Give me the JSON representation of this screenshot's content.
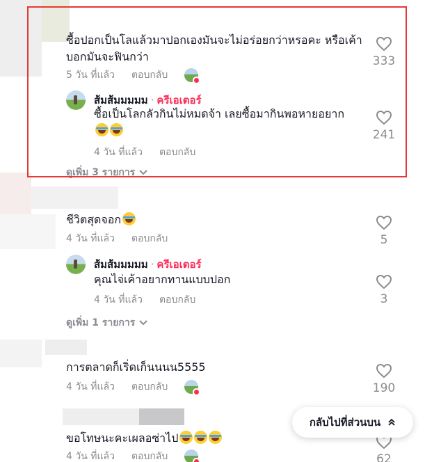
{
  "comments": [
    {
      "text": "ซื้อปอกเป็นโลแล้วมาปอกเองมันจะไม่อร่อยกว่าหรอคะ หรือเค้าบอกมันจะฟินกว่า",
      "date": "5 วัน ที่แล้ว",
      "reply_label": "ตอบกลับ",
      "likes": "333",
      "reply": {
        "name": "ส้มส้มมมมม",
        "role": "ครีเอเตอร์",
        "text": "ซื้อเป็นโลกลัวกินไม่หมดจ้า เลยซื้อมากินพอหายอยาก",
        "date": "4 วัน ที่แล้ว",
        "reply_label": "ตอบกลับ",
        "likes": "241"
      },
      "more": "ดูเพิ่ม 3 รายการ"
    },
    {
      "text": "ชีวิตสุดจอก",
      "date": "4 วัน ที่แล้ว",
      "reply_label": "ตอบกลับ",
      "likes": "5",
      "reply": {
        "name": "ส้มส้มมมมม",
        "role": "ครีเอเตอร์",
        "text": "คุณไจ่เค้าอยากทานแบบปอก",
        "date": "4 วัน ที่แล้ว",
        "reply_label": "ตอบกลับ",
        "likes": "3"
      },
      "more": "ดูเพิ่ม 1 รายการ"
    },
    {
      "text": "การตลาดก็เริ่ดเก็นนนน5555",
      "date": "4 วัน ที่แล้ว",
      "reply_label": "ตอบกลับ",
      "likes": "190"
    },
    {
      "text": "ขอโทษนะคะเผลอซ่าไป",
      "date": "4 วัน ที่แล้ว",
      "reply_label": "ตอบกลับ",
      "likes": "62"
    }
  ],
  "back_to_top": "กลับไปที่ส่วนบน",
  "colors": {
    "creator": "#fe2c55",
    "highlight": "#e53935",
    "muted": "#8a8b91"
  }
}
